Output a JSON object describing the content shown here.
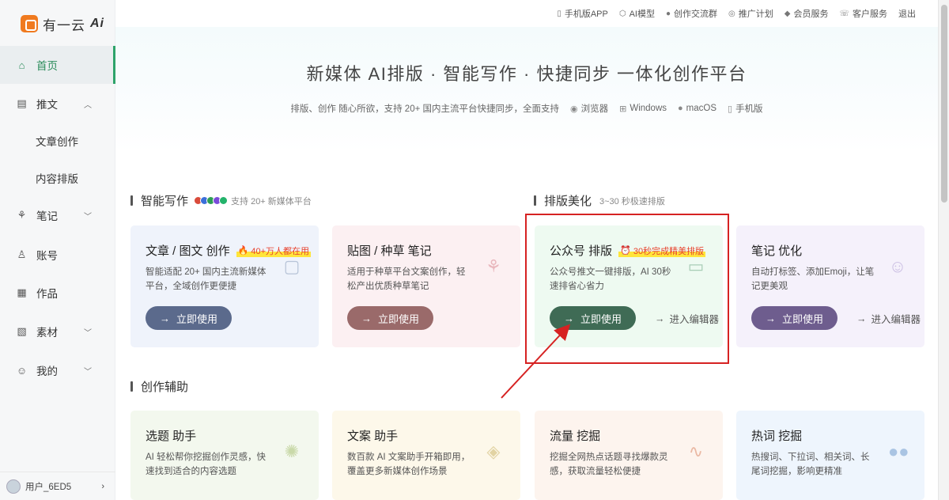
{
  "brand": {
    "name": "有一云",
    "ai": "Ai"
  },
  "sidebar": {
    "items": [
      {
        "label": "首页",
        "icon": "home-icon"
      },
      {
        "label": "推文",
        "icon": "article-icon"
      },
      {
        "label": "文章创作"
      },
      {
        "label": "内容排版"
      },
      {
        "label": "笔记",
        "icon": "sprout-icon"
      },
      {
        "label": "账号",
        "icon": "users-icon"
      },
      {
        "label": "作品",
        "icon": "grid-icon"
      },
      {
        "label": "素材",
        "icon": "image-icon"
      },
      {
        "label": "我的",
        "icon": "user-icon"
      }
    ],
    "user": "用户_6ED5"
  },
  "topbar": {
    "links": [
      "手机版APP",
      "AI模型",
      "创作交流群",
      "推广计划",
      "会员服务",
      "客户服务",
      "退出"
    ]
  },
  "hero": {
    "title": "新媒体 AI排版 · 智能写作 · 快捷同步 一体化创作平台",
    "subtitle": "排版、创作 随心所欲，支持 20+ 国内主流平台快捷同步，全面支持",
    "platforms": [
      "浏览器",
      "Windows",
      "macOS",
      "手机版"
    ]
  },
  "sections": {
    "writing": {
      "title": "智能写作",
      "hint": "支持 20+ 新媒体平台"
    },
    "layout": {
      "title": "排版美化",
      "hint": "3~30 秒极速排版"
    },
    "assist": {
      "title": "创作辅助"
    }
  },
  "cards": [
    {
      "title": "文章 / 图文 创作",
      "tag": "40+万人都在用",
      "desc": "智能适配 20+ 国内主流新媒体平台，全域创作更便捷",
      "button": "立即使用"
    },
    {
      "title": "贴图 / 种草 笔记",
      "desc": "适用于种草平台文案创作，轻松产出优质种草笔记",
      "button": "立即使用"
    },
    {
      "title": "公众号 排版",
      "tag": "30秒完成精美排版",
      "desc": "公众号推文一键排版，AI 30秒速排省心省力",
      "button": "立即使用",
      "editor": "进入编辑器"
    },
    {
      "title": "笔记 优化",
      "desc": "自动打标签、添加Emoji，让笔记更美观",
      "button": "立即使用",
      "editor": "进入编辑器"
    },
    {
      "title": "选题 助手",
      "desc": "AI 轻松帮你挖掘创作灵感，快速找到适合的内容选题"
    },
    {
      "title": "文案 助手",
      "desc": "数百款 AI 文案助手开箱即用，覆盖更多新媒体创作场景"
    },
    {
      "title": "流量 挖掘",
      "desc": "挖掘全网热点话题寻找爆款灵感，获取流量轻松便捷"
    },
    {
      "title": "热词 挖掘",
      "desc": "热搜词、下拉词、相关词、长尾词挖掘，影响更精准"
    }
  ],
  "colors": {
    "accent_green": "#2ea36a",
    "btn_blue": "#5b6a8c",
    "btn_pink": "#9a6a6a",
    "btn_green": "#3f6b55",
    "btn_purple": "#6e5d8e",
    "highlight_red": "#d62222"
  }
}
